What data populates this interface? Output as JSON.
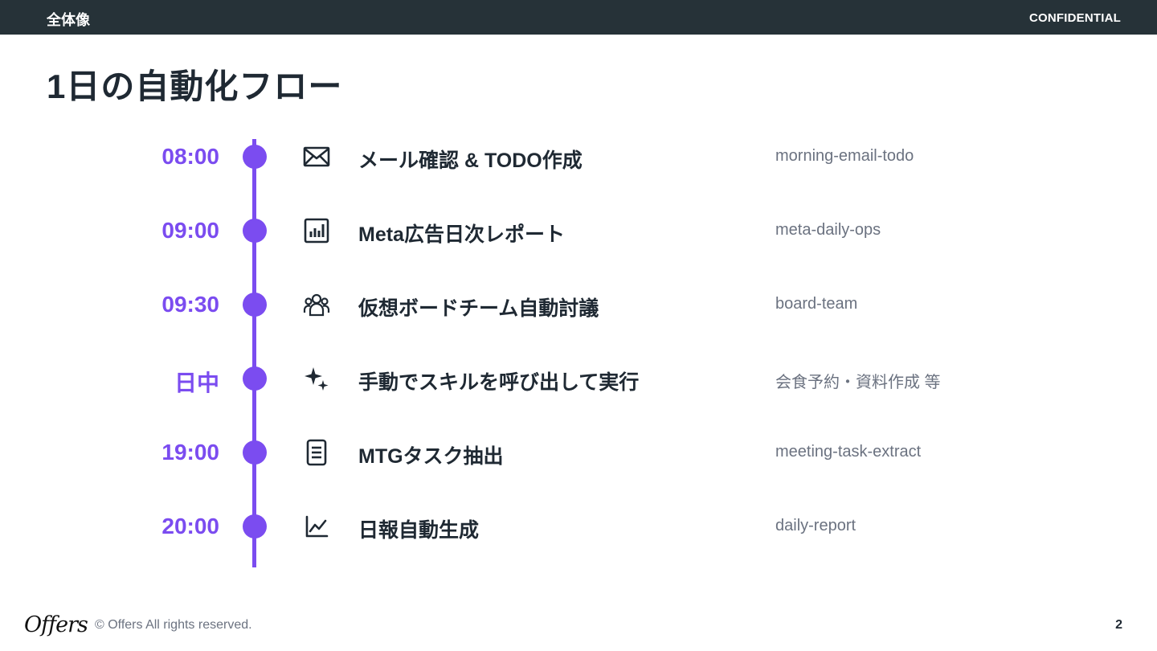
{
  "header": {
    "section": "全体像",
    "confidential": "CONFIDENTIAL"
  },
  "title": "1日の自動化フロー",
  "colors": {
    "accent": "#7b4cf0",
    "header_bg": "#263238",
    "text": "#1f2933",
    "muted": "#6b7280"
  },
  "timeline": [
    {
      "time": "08:00",
      "icon": "mail-icon",
      "label": "メール確認 & TODO作成",
      "skill": "morning-email-todo"
    },
    {
      "time": "09:00",
      "icon": "bar-chart-icon",
      "label": "Meta広告日次レポート",
      "skill": "meta-daily-ops"
    },
    {
      "time": "09:30",
      "icon": "team-icon",
      "label": "仮想ボードチーム自動討議",
      "skill": "board-team"
    },
    {
      "time": "日中",
      "icon": "sparkle-icon",
      "label": "手動でスキルを呼び出して実行",
      "skill": "会食予約・資料作成 等"
    },
    {
      "time": "19:00",
      "icon": "document-icon",
      "label": "MTGタスク抽出",
      "skill": "meeting-task-extract"
    },
    {
      "time": "20:00",
      "icon": "line-chart-icon",
      "label": "日報自動生成",
      "skill": "daily-report"
    }
  ],
  "footer": {
    "logo": "Offers",
    "copyright": "© Offers All rights reserved.",
    "page": "2"
  }
}
